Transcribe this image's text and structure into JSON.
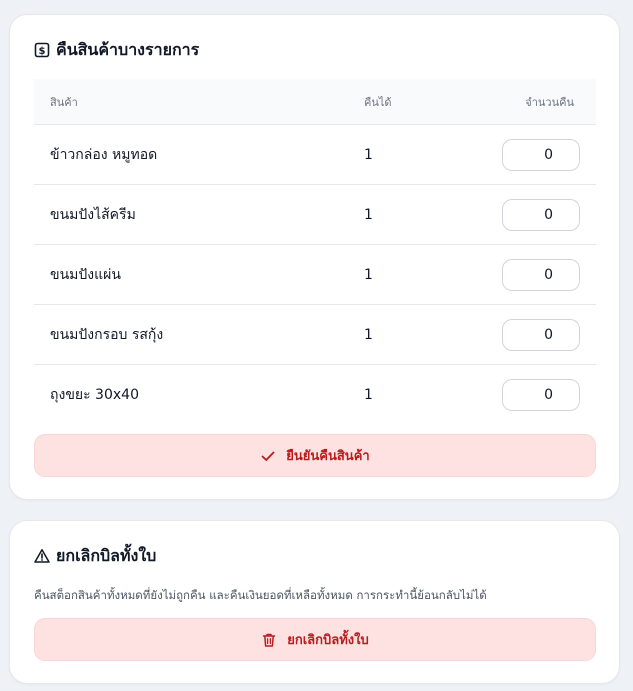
{
  "return_card": {
    "title": "คืนสินค้าบางรายการ",
    "title_icon": "dollar-bill-icon",
    "columns": {
      "product": "สินค้า",
      "returnable": "คืนได้",
      "return_qty": "จำนวนคืน"
    },
    "items": [
      {
        "name": "ข้าวกล่อง หมูทอด",
        "returnable": "1",
        "qty": "0"
      },
      {
        "name": "ขนมปังไส้ครีม",
        "returnable": "1",
        "qty": "0"
      },
      {
        "name": "ขนมปังแผ่น",
        "returnable": "1",
        "qty": "0"
      },
      {
        "name": "ขนมปังกรอบ รสกุ้ง",
        "returnable": "1",
        "qty": "0"
      },
      {
        "name": "ถุงขยะ 30x40",
        "returnable": "1",
        "qty": "0"
      }
    ],
    "confirm_label": "ยืนยันคืนสินค้า",
    "confirm_icon": "check-icon"
  },
  "cancel_card": {
    "title": "ยกเลิกบิลทั้งใบ",
    "title_icon": "warning-icon",
    "description": "คืนสต็อกสินค้าทั้งหมดที่ยังไม่ถูกคืน และคืนเงินยอดที่เหลือทั้งหมด การกระทำนี้ย้อนกลับไม่ได้",
    "button_label": "ยกเลิกบิลทั้งใบ",
    "button_icon": "trash-icon"
  },
  "colors": {
    "page_bg": "#eef1f5",
    "danger_bg": "#fee2e2",
    "danger_text": "#b91c1c"
  }
}
